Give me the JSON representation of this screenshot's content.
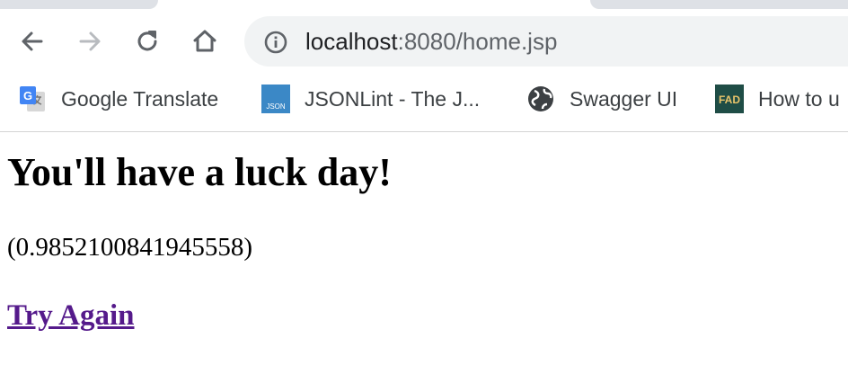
{
  "browser": {
    "url_host": "localhost",
    "url_rest": ":8080/home.jsp",
    "nav": {
      "back_icon": "arrow-left-icon",
      "forward_icon": "arrow-right-icon",
      "reload_icon": "reload-icon",
      "home_icon": "home-icon",
      "site_info_icon": "info-icon"
    },
    "bookmarks": [
      {
        "label": "Google Translate",
        "icon": "google-translate-icon"
      },
      {
        "label": "JSONLint - The J...",
        "icon": "jsonlint-icon",
        "icon_text": "JSON"
      },
      {
        "label": "Swagger UI",
        "icon": "globe-icon"
      },
      {
        "label": "How to u",
        "icon": "fad-icon",
        "icon_text": "FAD"
      }
    ]
  },
  "page": {
    "heading": "You'll have a luck day!",
    "number": "(0.9852100841945558)",
    "link_label": "Try Again"
  },
  "colors": {
    "link_visited": "#551a8b",
    "omnibox_bg": "#f1f3f4",
    "tab_bg": "#dee1e6"
  }
}
